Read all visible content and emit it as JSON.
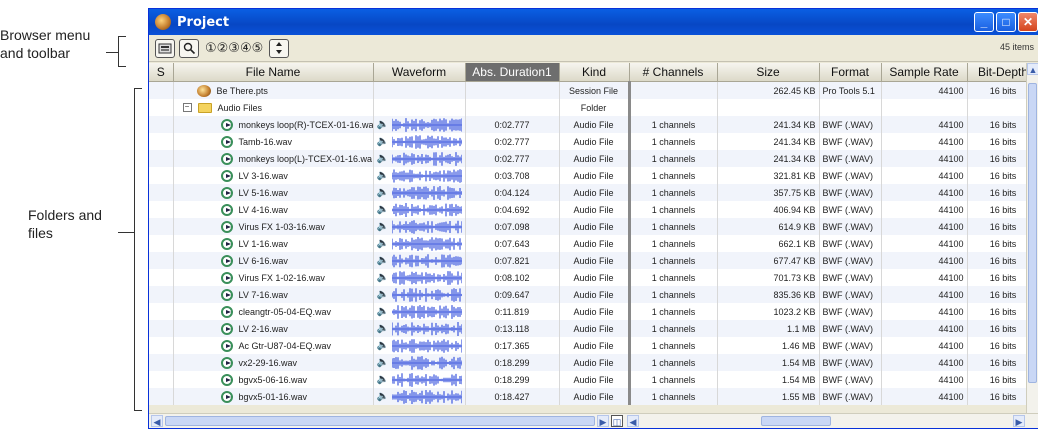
{
  "annotations": {
    "browser_menu": [
      "Browser menu",
      "and toolbar"
    ],
    "folders_files": [
      "Folders and",
      "files"
    ]
  },
  "window": {
    "title": "Project",
    "controls": [
      "minimize",
      "maximize",
      "close"
    ]
  },
  "toolbar": {
    "buttons": [
      "browser-menu-icon",
      "search-icon"
    ],
    "view_presets": "①②③④⑤",
    "sort_button": "sort-icon",
    "item_count": "45 items"
  },
  "columns": [
    "S",
    "File Name",
    "Waveform",
    "Abs. Duration1",
    "Kind",
    "# Channels",
    "Size",
    "Format",
    "Sample Rate",
    "Bit-Depth"
  ],
  "active_column": "Abs. Duration1",
  "rows": [
    {
      "type": "session",
      "name": "Be There.pts",
      "duration": "",
      "kind": "Session File",
      "channels": "",
      "size": "262.45 KB",
      "format": "Pro Tools 5.1",
      "rate": "44100",
      "bits": "16 bits"
    },
    {
      "type": "folder",
      "name": "Audio Files",
      "duration": "",
      "kind": "Folder",
      "channels": "",
      "size": "",
      "format": "",
      "rate": "",
      "bits": ""
    },
    {
      "type": "audio",
      "name": "monkeys loop(R)-TCEX-01-16.wa",
      "duration": "0:02.777",
      "kind": "Audio File",
      "channels": "1 channels",
      "size": "241.34 KB",
      "format": "BWF (.WAV)",
      "rate": "44100",
      "bits": "16 bits"
    },
    {
      "type": "audio",
      "name": "Tamb-16.wav",
      "duration": "0:02.777",
      "kind": "Audio File",
      "channels": "1 channels",
      "size": "241.34 KB",
      "format": "BWF (.WAV)",
      "rate": "44100",
      "bits": "16 bits"
    },
    {
      "type": "audio",
      "name": "monkeys loop(L)-TCEX-01-16.wa",
      "duration": "0:02.777",
      "kind": "Audio File",
      "channels": "1 channels",
      "size": "241.34 KB",
      "format": "BWF (.WAV)",
      "rate": "44100",
      "bits": "16 bits"
    },
    {
      "type": "audio",
      "name": "LV 3-16.wav",
      "duration": "0:03.708",
      "kind": "Audio File",
      "channels": "1 channels",
      "size": "321.81 KB",
      "format": "BWF (.WAV)",
      "rate": "44100",
      "bits": "16 bits"
    },
    {
      "type": "audio",
      "name": "LV 5-16.wav",
      "duration": "0:04.124",
      "kind": "Audio File",
      "channels": "1 channels",
      "size": "357.75 KB",
      "format": "BWF (.WAV)",
      "rate": "44100",
      "bits": "16 bits"
    },
    {
      "type": "audio",
      "name": "LV 4-16.wav",
      "duration": "0:04.692",
      "kind": "Audio File",
      "channels": "1 channels",
      "size": "406.94 KB",
      "format": "BWF (.WAV)",
      "rate": "44100",
      "bits": "16 bits"
    },
    {
      "type": "audio",
      "name": "Virus FX 1-03-16.wav",
      "duration": "0:07.098",
      "kind": "Audio File",
      "channels": "1 channels",
      "size": "614.9 KB",
      "format": "BWF (.WAV)",
      "rate": "44100",
      "bits": "16 bits"
    },
    {
      "type": "audio",
      "name": "LV 1-16.wav",
      "duration": "0:07.643",
      "kind": "Audio File",
      "channels": "1 channels",
      "size": "662.1 KB",
      "format": "BWF (.WAV)",
      "rate": "44100",
      "bits": "16 bits"
    },
    {
      "type": "audio",
      "name": "LV 6-16.wav",
      "duration": "0:07.821",
      "kind": "Audio File",
      "channels": "1 channels",
      "size": "677.47 KB",
      "format": "BWF (.WAV)",
      "rate": "44100",
      "bits": "16 bits"
    },
    {
      "type": "audio",
      "name": "Virus FX 1-02-16.wav",
      "duration": "0:08.102",
      "kind": "Audio File",
      "channels": "1 channels",
      "size": "701.73 KB",
      "format": "BWF (.WAV)",
      "rate": "44100",
      "bits": "16 bits"
    },
    {
      "type": "audio",
      "name": "LV 7-16.wav",
      "duration": "0:09.647",
      "kind": "Audio File",
      "channels": "1 channels",
      "size": "835.36 KB",
      "format": "BWF (.WAV)",
      "rate": "44100",
      "bits": "16 bits"
    },
    {
      "type": "audio",
      "name": "cleangtr-05-04-EQ.wav",
      "duration": "0:11.819",
      "kind": "Audio File",
      "channels": "1 channels",
      "size": "1023.2 KB",
      "format": "BWF (.WAV)",
      "rate": "44100",
      "bits": "16 bits"
    },
    {
      "type": "audio",
      "name": "LV 2-16.wav",
      "duration": "0:13.118",
      "kind": "Audio File",
      "channels": "1 channels",
      "size": "1.1 MB",
      "format": "BWF (.WAV)",
      "rate": "44100",
      "bits": "16 bits"
    },
    {
      "type": "audio",
      "name": "Ac Gtr-U87-04-EQ.wav",
      "duration": "0:17.365",
      "kind": "Audio File",
      "channels": "1 channels",
      "size": "1.46 MB",
      "format": "BWF (.WAV)",
      "rate": "44100",
      "bits": "16 bits"
    },
    {
      "type": "audio",
      "name": "vx2-29-16.wav",
      "duration": "0:18.299",
      "kind": "Audio File",
      "channels": "1 channels",
      "size": "1.54 MB",
      "format": "BWF (.WAV)",
      "rate": "44100",
      "bits": "16 bits"
    },
    {
      "type": "audio",
      "name": "bgvx5-06-16.wav",
      "duration": "0:18.299",
      "kind": "Audio File",
      "channels": "1 channels",
      "size": "1.54 MB",
      "format": "BWF (.WAV)",
      "rate": "44100",
      "bits": "16 bits"
    },
    {
      "type": "audio",
      "name": "bgvx5-01-16.wav",
      "duration": "0:18.427",
      "kind": "Audio File",
      "channels": "1 channels",
      "size": "1.55 MB",
      "format": "BWF (.WAV)",
      "rate": "44100",
      "bits": "16 bits"
    }
  ],
  "colors": {
    "titlebar": "#0747c4",
    "waveform": "#4a63e0",
    "active_header": "#6e6e6e"
  }
}
